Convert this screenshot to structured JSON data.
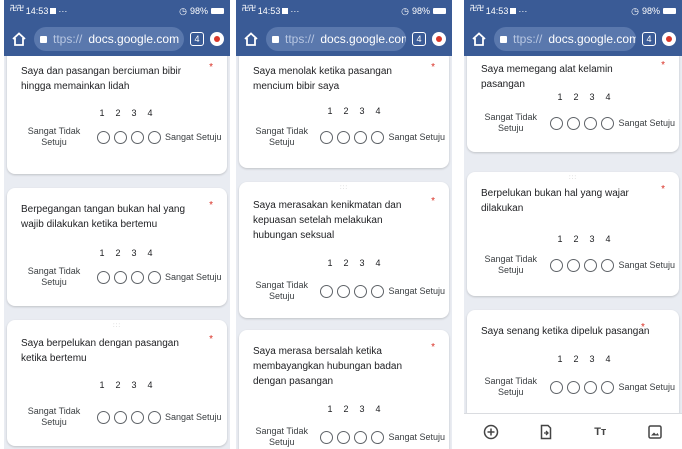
{
  "status_bar": {
    "signal": "࿖࿖",
    "time": "14:53",
    "battery": "98%"
  },
  "address_bar": {
    "scheme": "ttps://",
    "host": "docs.google.com",
    "tab_count": "4"
  },
  "scale": {
    "numbers": [
      "1",
      "2",
      "3",
      "4"
    ],
    "low_label": "Sangat Tidak Setuju",
    "high_label": "Sangat Setuju",
    "required_mark": "*"
  },
  "screens": [
    {
      "questions": [
        {
          "text": "Saya dan pasangan berciuman bibir hingga memainkan lidah"
        },
        {
          "text": "Berpegangan tangan bukan hal yang wajib dilakukan ketika bertemu"
        },
        {
          "text": "Saya berpelukan dengan pasangan ketika bertemu"
        }
      ]
    },
    {
      "questions": [
        {
          "text": "Saya menolak ketika pasangan mencium bibir saya"
        },
        {
          "text": "Saya merasakan kenikmatan dan kepuasan setelah melakukan hubungan seksual"
        },
        {
          "text": "Saya merasa bersalah ketika membayangkan hubungan badan dengan pasangan"
        }
      ]
    },
    {
      "questions": [
        {
          "text": "Saya memegang alat kelamin pasangan"
        },
        {
          "text": "Berpelukan bukan hal yang wajar dilakukan"
        },
        {
          "text": "Saya senang ketika dipeluk pasangan"
        }
      ]
    }
  ],
  "bottom_toolbar": {
    "text_format_label": "Tт"
  }
}
